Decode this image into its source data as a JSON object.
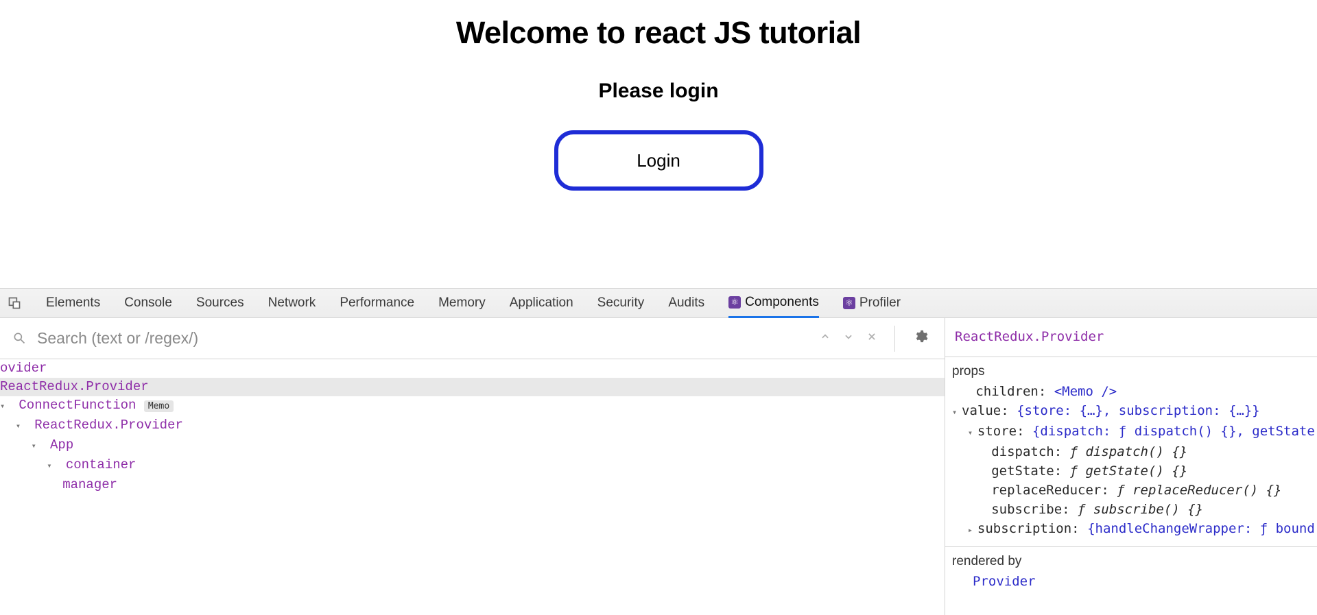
{
  "app": {
    "heading": "Welcome to react JS tutorial",
    "sub": "Please login",
    "login_label": "Login"
  },
  "devtools": {
    "tabs": [
      "Elements",
      "Console",
      "Sources",
      "Network",
      "Performance",
      "Memory",
      "Application",
      "Security",
      "Audits"
    ],
    "react_tabs": [
      "Components",
      "Profiler"
    ],
    "active_tab": "Components",
    "search_placeholder": "Search (text or /regex/)",
    "tree": {
      "rows": [
        {
          "indent": 0,
          "twisty": "",
          "label": "ovider",
          "selected": false,
          "memo": false
        },
        {
          "indent": 0,
          "twisty": "",
          "label": "ReactRedux.Provider",
          "selected": true,
          "memo": false
        },
        {
          "indent": 0,
          "twisty": "▾",
          "label": "ConnectFunction",
          "selected": false,
          "memo": true
        },
        {
          "indent": 1,
          "twisty": "▾",
          "label": "ReactRedux.Provider",
          "selected": false,
          "memo": false
        },
        {
          "indent": 2,
          "twisty": "▾",
          "label": "App",
          "selected": false,
          "memo": false
        },
        {
          "indent": 3,
          "twisty": "▾",
          "label": "container",
          "selected": false,
          "memo": false
        },
        {
          "indent": 4,
          "twisty": "",
          "label": "manager",
          "selected": false,
          "memo": false
        }
      ],
      "memo_badge": "Memo"
    },
    "right": {
      "title": "ReactRedux.Provider",
      "props_hdr": "props",
      "props": {
        "children": "<Memo />",
        "value_summary": "{store: {…}, subscription: {…}}",
        "store_summary": "{dispatch: ƒ dispatch() {}, getState: ƒ getState(",
        "dispatch": "ƒ dispatch() {}",
        "getState": "ƒ getState() {}",
        "replaceReducer": "ƒ replaceReducer() {}",
        "subscribe": "ƒ subscribe() {}",
        "subscription_summary": "{handleChangeWrapper: ƒ bound handleChange"
      },
      "rendered_hdr": "rendered by",
      "rendered_link": "Provider"
    }
  }
}
